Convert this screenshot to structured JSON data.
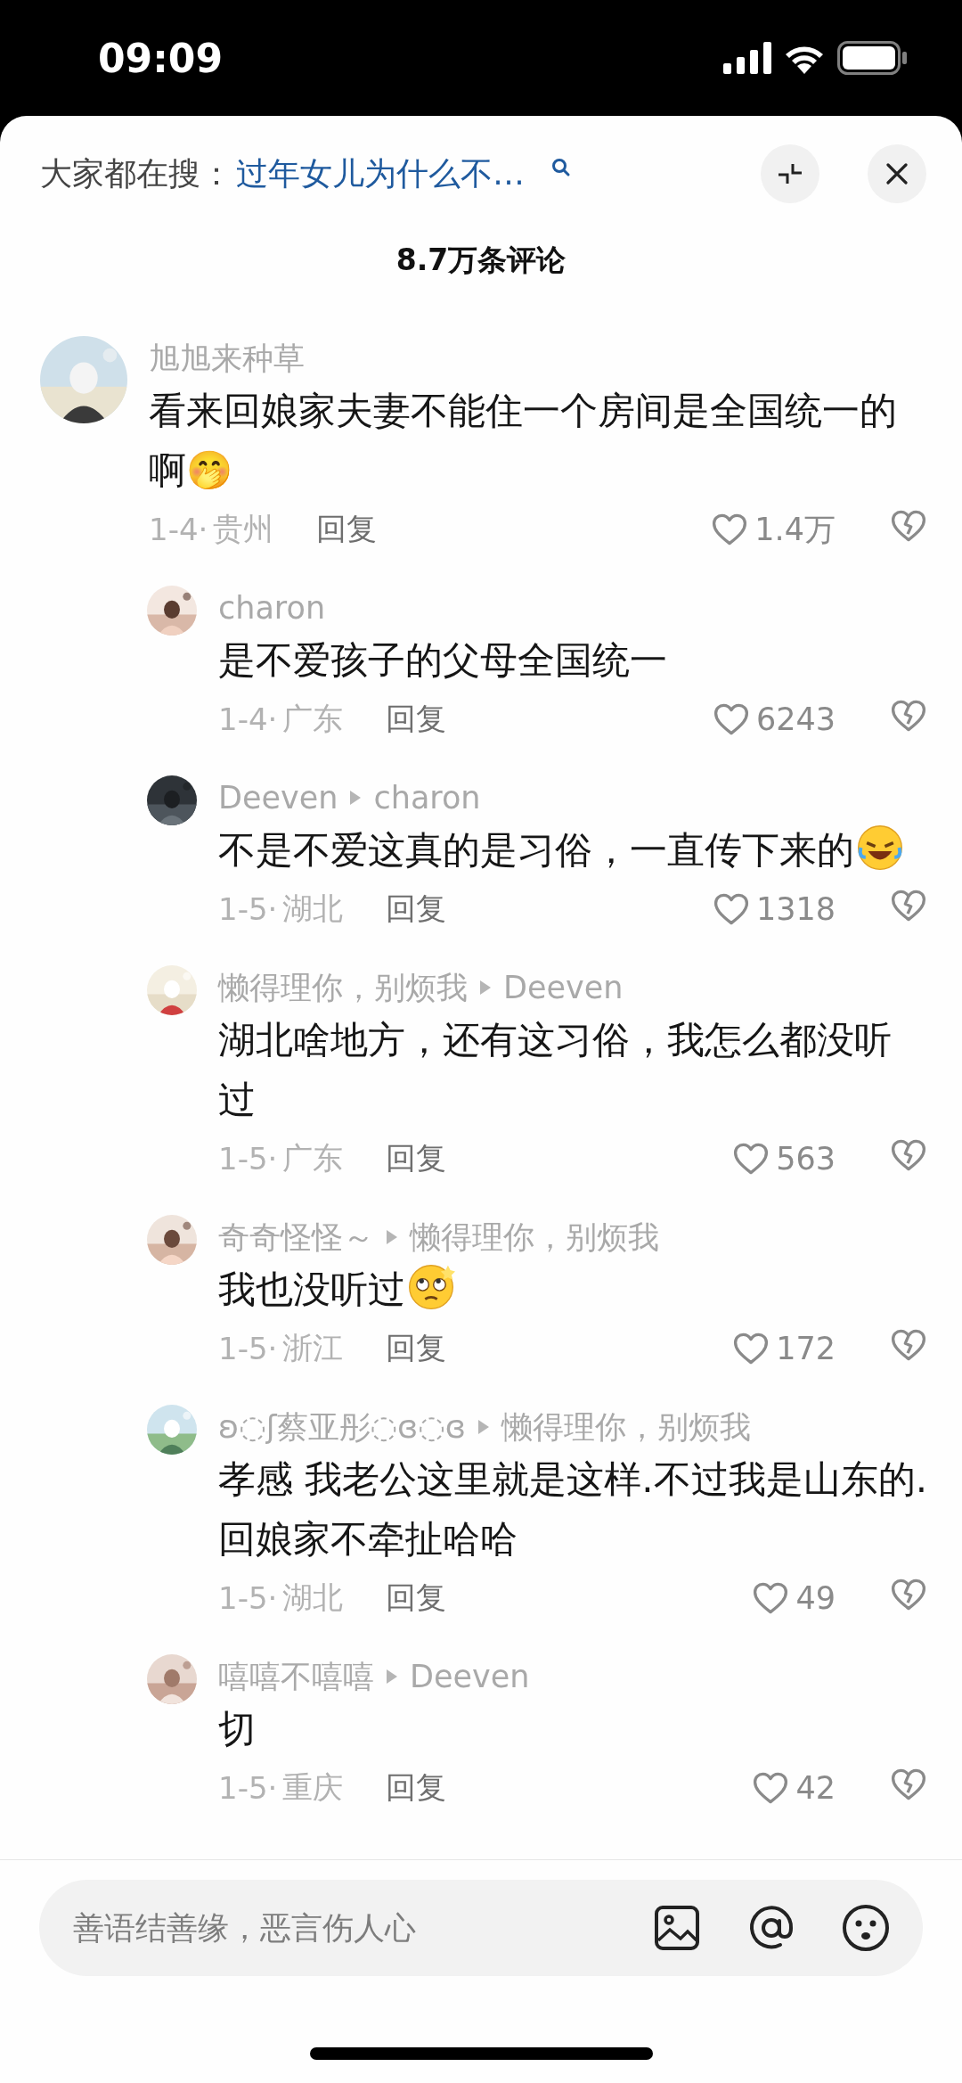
{
  "status_bar": {
    "time": "09:09"
  },
  "search_bar": {
    "label": "大家都在搜：",
    "query": "过年女儿为什么不…"
  },
  "comment_count": "8.7万条评论",
  "comments": [
    {
      "kind": "comment",
      "name": "旭旭来种草",
      "text": "看来回娘家夫妻不能住一个房间是全国统一的啊🤭",
      "date": "1-4·",
      "region": "贵州",
      "reply_label": "回复",
      "likes": "1.4万"
    },
    {
      "kind": "reply",
      "name": "charon",
      "text": "是不爱孩子的父母全国统一",
      "date": "1-4·",
      "region": "广东",
      "reply_label": "回复",
      "likes": "6243"
    },
    {
      "kind": "reply",
      "name": "Deeven",
      "reply_to": "charon",
      "text": "不是不爱这真的是习俗，一直传下来的",
      "emoji": {
        "kind": "laugh"
      },
      "date": "1-5·",
      "region": "湖北",
      "reply_label": "回复",
      "likes": "1318"
    },
    {
      "kind": "reply",
      "name": "懒得理你，别烦我",
      "reply_to": "Deeven",
      "text": "湖北啥地方，还有这习俗，我怎么都没听过",
      "date": "1-5·",
      "region": "广东",
      "reply_label": "回复",
      "likes": "563"
    },
    {
      "kind": "reply",
      "name": "奇奇怪怪～",
      "reply_to": "懒得理你，别烦我",
      "text": "我也没听过",
      "emoji": {
        "kind": "dizzy"
      },
      "date": "1-5·",
      "region": "浙江",
      "reply_label": "回复",
      "likes": "172"
    },
    {
      "kind": "reply",
      "name": "ʚ◌ʃ蔡亚彤◌ɞ◌ɞ",
      "reply_to": "懒得理你，别烦我",
      "text": "孝感 我老公这里就是这样.不过我是山东的.回娘家不牵扯哈哈",
      "date": "1-5·",
      "region": "湖北",
      "reply_label": "回复",
      "likes": "49"
    },
    {
      "kind": "reply",
      "name": "嘻嘻不嘻嘻",
      "reply_to": "Deeven",
      "text": "切",
      "date": "1-5·",
      "region": "重庆",
      "reply_label": "回复",
      "likes": "42"
    }
  ],
  "input": {
    "placeholder": "善语结善缘，恶言伤人心"
  }
}
